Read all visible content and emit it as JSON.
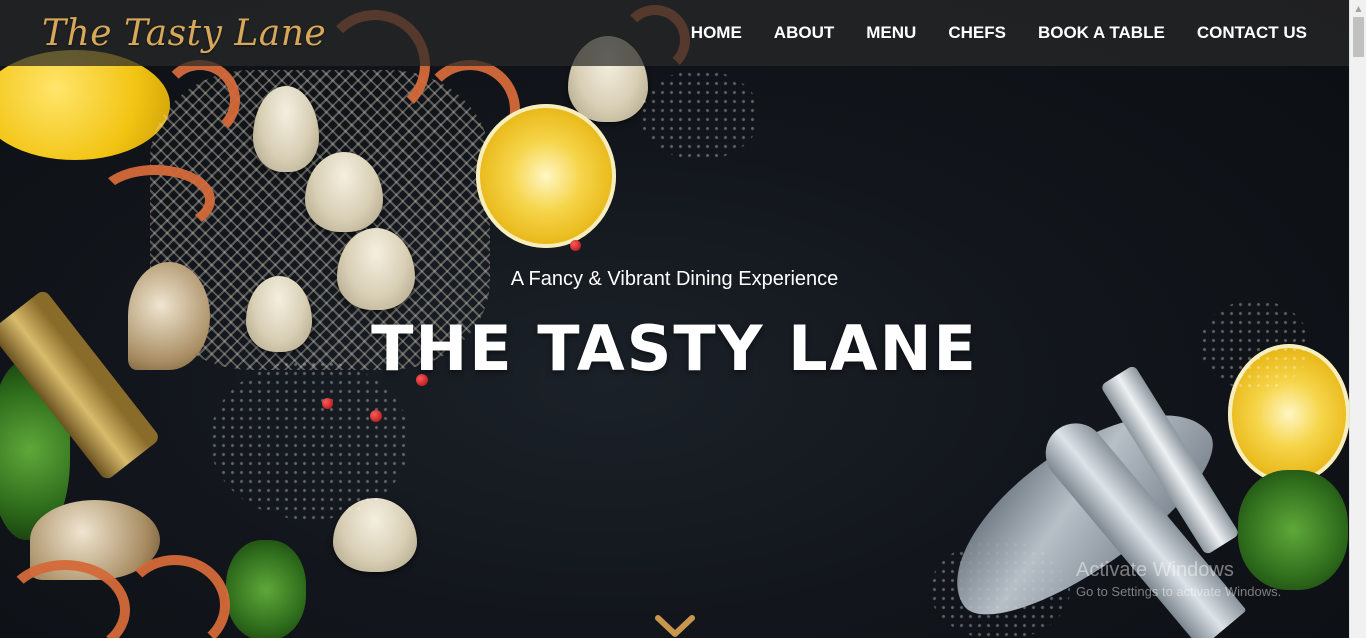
{
  "brand": {
    "name": "The Tasty Lane"
  },
  "nav": {
    "items": [
      {
        "label": "HOME"
      },
      {
        "label": "ABOUT"
      },
      {
        "label": "MENU"
      },
      {
        "label": "CHEFS"
      },
      {
        "label": "BOOK A TABLE"
      },
      {
        "label": "CONTACT US"
      }
    ]
  },
  "hero": {
    "tagline": "A Fancy & Vibrant Dining Experience",
    "title": "THE TASTY LANE",
    "scroll_icon": "chevron-down-icon"
  },
  "watermark": {
    "title": "Activate Windows",
    "subtitle": "Go to Settings to activate Windows."
  },
  "colors": {
    "brand_gold": "#d8a85a",
    "nav_bg": "rgba(40,40,40,0.72)",
    "chevron": "#c8964c",
    "text": "#ffffff"
  }
}
